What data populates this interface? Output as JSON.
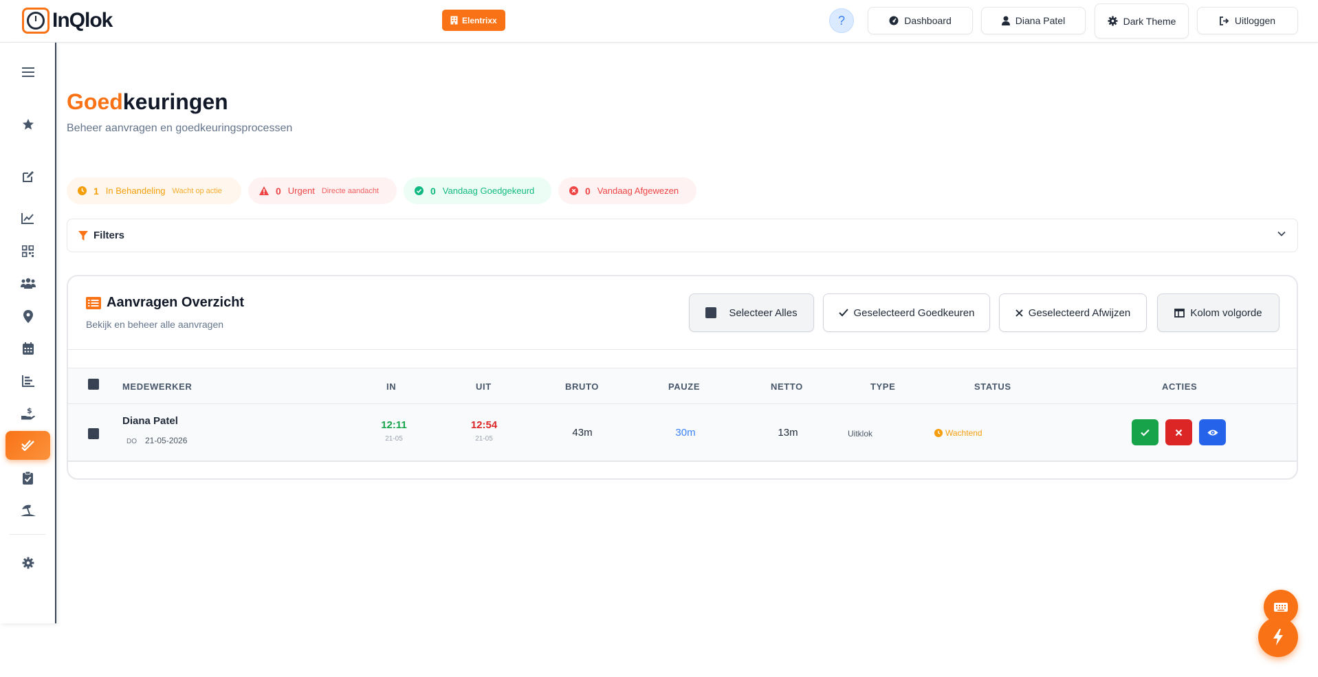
{
  "app": {
    "name": "InQlok",
    "company": "Elentrixx"
  },
  "header": {
    "help_label": "?",
    "dashboard": "Dashboard",
    "user": "Diana Patel",
    "theme": "Dark Theme",
    "logout": "Uitloggen"
  },
  "sidebar": {
    "items": [
      "menu-icon",
      "star-icon",
      "edit-icon",
      "chart-line-icon",
      "qrcode-icon",
      "users-icon",
      "location-pin-icon",
      "calendar-icon",
      "bar-chart-icon",
      "hand-dollar-icon",
      "double-check-icon",
      "clipboard-check-icon",
      "umbrella-beach-icon",
      "gear-icon"
    ],
    "active": "double-check-icon"
  },
  "page": {
    "title_accent": "Goed",
    "title_rest": "keuringen",
    "subtitle": "Beheer aanvragen en goedkeuringsprocessen"
  },
  "stats": [
    {
      "count": "1",
      "label": "In Behandeling",
      "sub": "Wacht op actie",
      "color": "#f59e0b"
    },
    {
      "count": "0",
      "label": "Urgent",
      "sub": "Directe aandacht",
      "color": "#ef4444"
    },
    {
      "count": "0",
      "label": "Vandaag Goedgekeurd",
      "sub": "",
      "color": "#10b981"
    },
    {
      "count": "0",
      "label": "Vandaag Afgewezen",
      "sub": "",
      "color": "#ef4444"
    }
  ],
  "filters": {
    "label": "Filters"
  },
  "overview": {
    "title": "Aanvragen Overzicht",
    "subtitle": "Bekijk en beheer alle aanvragen",
    "buttons": {
      "select_all": "Selecteer Alles",
      "approve_selected": "Geselecteerd Goedkeuren",
      "reject_selected": "Geselecteerd Afwijzen",
      "column_order": "Kolom volgorde"
    }
  },
  "table": {
    "columns": [
      "MEDEWERKER",
      "IN",
      "UIT",
      "BRUTO",
      "PAUZE",
      "NETTO",
      "TYPE",
      "STATUS",
      "ACTIES"
    ],
    "rows": [
      {
        "employee": "Diana Patel",
        "day": "DO",
        "date": "21-05-2026",
        "in_time": "12:11",
        "in_date": "21-05",
        "out_time": "12:54",
        "out_date": "21-05",
        "bruto": "43m",
        "pauze": "30m",
        "netto": "13m",
        "type": "Uitklok",
        "status": "Wachtend"
      }
    ]
  },
  "colors": {
    "accent": "#f97316",
    "approve": "#16a34a",
    "reject": "#dc2626",
    "view": "#2563eb"
  }
}
